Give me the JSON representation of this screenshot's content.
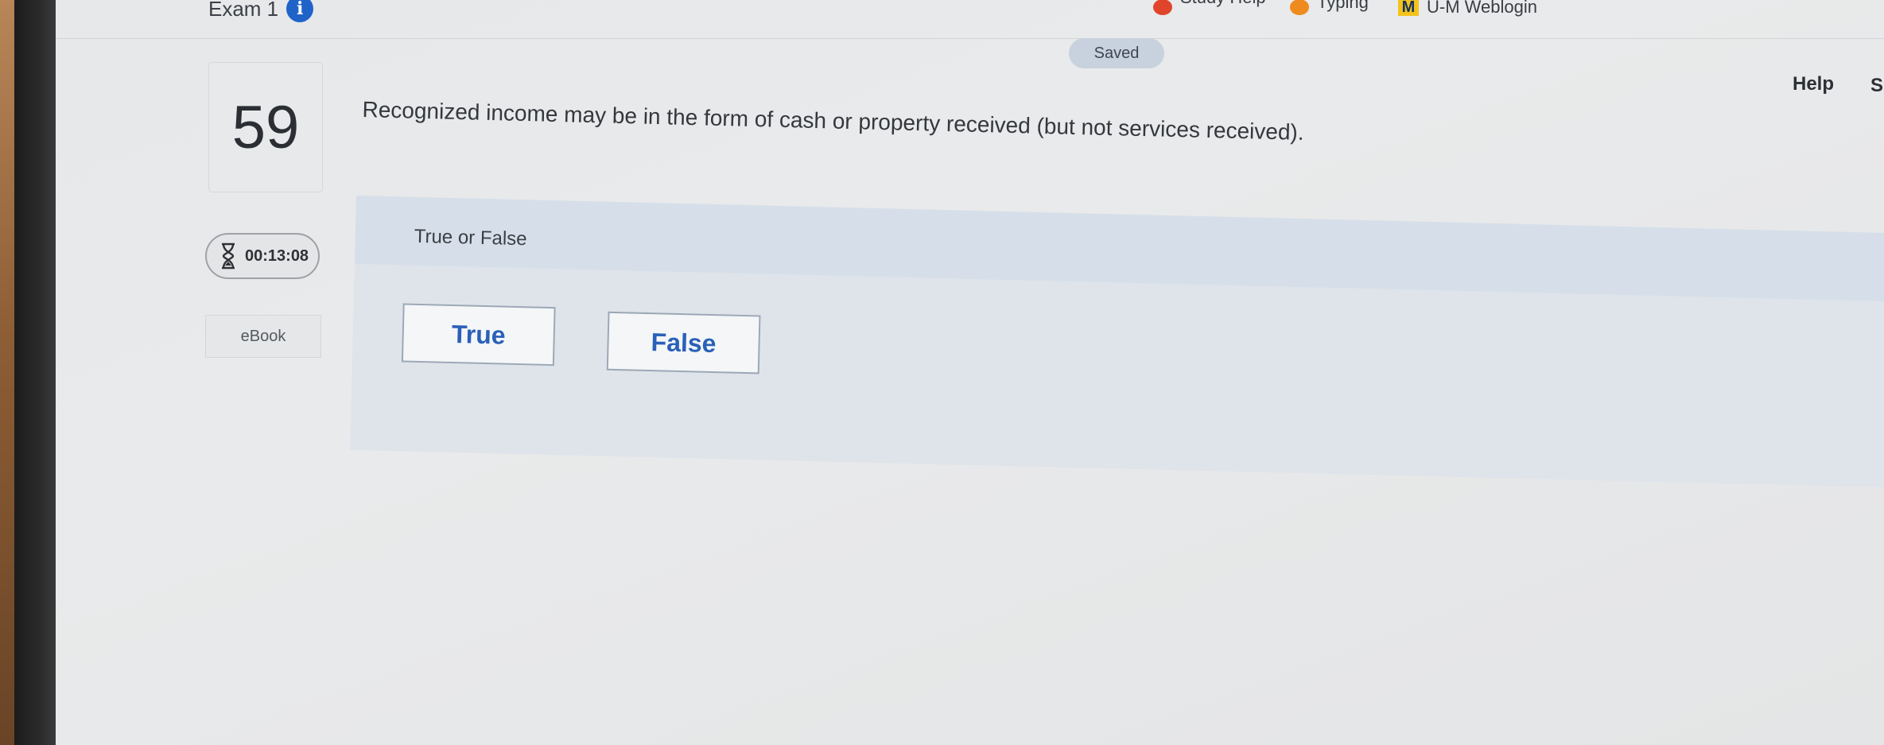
{
  "exam": {
    "title": "Exam 1"
  },
  "bookmarks": [
    {
      "label": "Study Help",
      "icon": "study-help-icon"
    },
    {
      "label": "Typing",
      "icon": "typing-icon"
    },
    {
      "label": "U-M Weblogin",
      "icon": "michigan-m-logo"
    }
  ],
  "header": {
    "saved_label": "Saved",
    "help_label": "Help",
    "truncated_label": "S"
  },
  "question": {
    "number": "59",
    "text": "Recognized income may be in the form of cash or property received (but not services received).",
    "type_label": "True or False",
    "options": [
      "True",
      "False"
    ]
  },
  "sidebar": {
    "timer": "00:13:08",
    "ebook_label": "eBook"
  },
  "colors": {
    "accent": "#2a60b8",
    "info": "#1f63c8",
    "panel": "#dfe4ea",
    "panel_header": "#d6dfe9"
  }
}
